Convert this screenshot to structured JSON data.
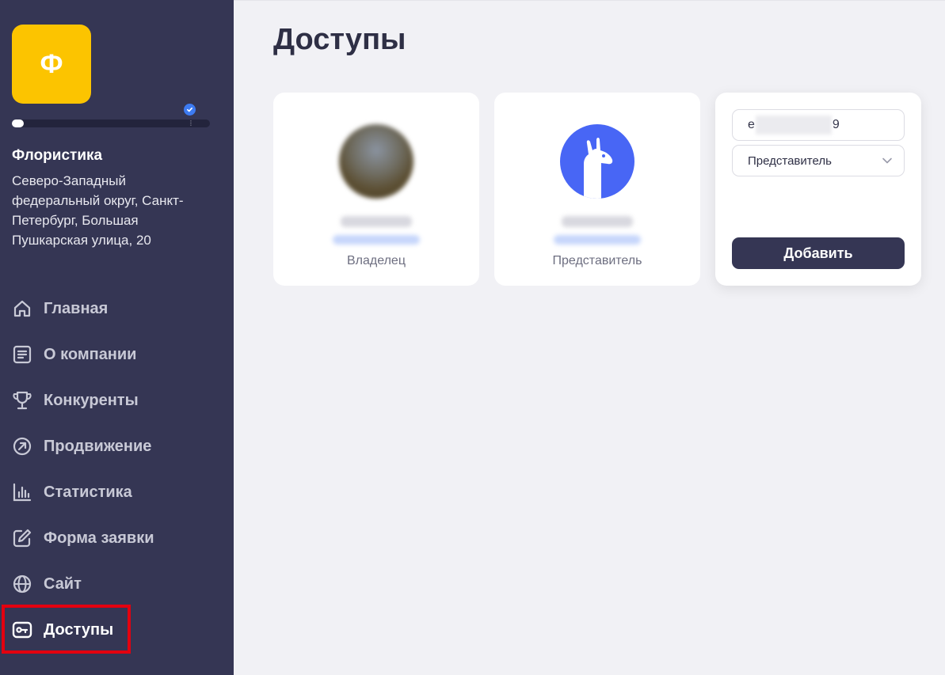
{
  "company": {
    "logo_letter": "Ф",
    "name": "Флористика",
    "address": "Северо-Западный федеральный округ, Санкт-Петербург, Большая Пушкарская улица, 20",
    "profile_progress": 0.06,
    "progress_menu": "⋮",
    "verified_icon": "check-badge-icon",
    "logo_color": "#fcc400"
  },
  "sidebar": {
    "items": [
      {
        "label": "Главная",
        "icon": "home-icon"
      },
      {
        "label": "О компании",
        "icon": "document-icon"
      },
      {
        "label": "Конкуренты",
        "icon": "trophy-icon"
      },
      {
        "label": "Продвижение",
        "icon": "arrow-circle-icon"
      },
      {
        "label": "Статистика",
        "icon": "bar-chart-icon"
      },
      {
        "label": "Форма заявки",
        "icon": "edit-icon"
      },
      {
        "label": "Сайт",
        "icon": "globe-icon"
      },
      {
        "label": "Доступы",
        "icon": "key-icon",
        "active": true
      }
    ],
    "background": "#353654",
    "highlight_color": "#e3000f"
  },
  "main": {
    "title": "Доступы",
    "cards": [
      {
        "role": "Владелец",
        "avatar": "photo-avatar"
      },
      {
        "role": "Представитель",
        "avatar": "llama-icon",
        "avatar_color": "#4866f5"
      }
    ],
    "add_form": {
      "email_prefix": "e",
      "email_suffix": "9",
      "role_selected": "Представитель",
      "submit_label": "Добавить"
    }
  }
}
